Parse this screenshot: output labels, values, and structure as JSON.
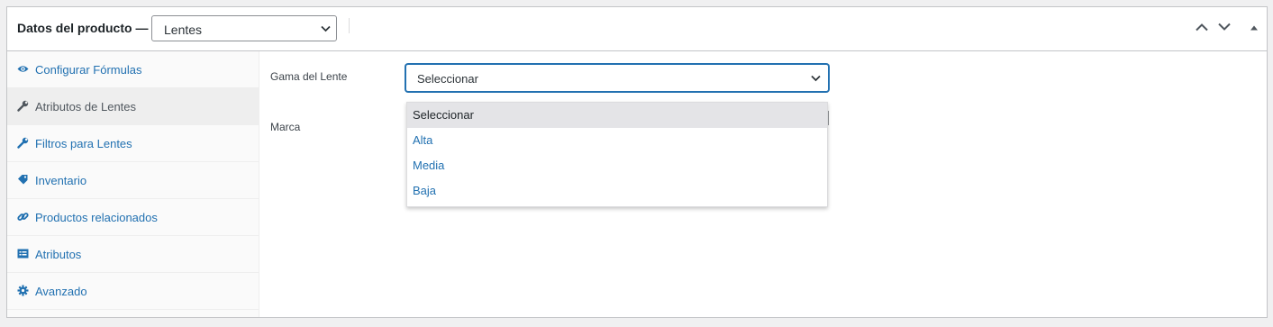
{
  "header": {
    "title": "Datos del producto —",
    "product_type": "Lentes"
  },
  "tabs": [
    {
      "label": "Configurar Fórmulas",
      "icon": "eye-icon",
      "active": false
    },
    {
      "label": "Atributos de Lentes",
      "icon": "wrench-icon",
      "active": true
    },
    {
      "label": "Filtros para Lentes",
      "icon": "wrench-icon",
      "active": false
    },
    {
      "label": "Inventario",
      "icon": "tag-icon",
      "active": false
    },
    {
      "label": "Productos relacionados",
      "icon": "link-icon",
      "active": false
    },
    {
      "label": "Atributos",
      "icon": "table-icon",
      "active": false
    },
    {
      "label": "Avanzado",
      "icon": "gear-icon",
      "active": false
    }
  ],
  "fields": {
    "gama_label": "Gama del Lente",
    "gama_value": "Seleccionar",
    "gama_options": [
      "Seleccionar",
      "Alta",
      "Media",
      "Baja"
    ],
    "marca_label": "Marca"
  },
  "colors": {
    "link": "#2271b1",
    "text": "#1d2327",
    "border": "#c3c4c7",
    "active_tab_bg": "#eeeeee",
    "option_highlight": "#e4e4e7"
  }
}
